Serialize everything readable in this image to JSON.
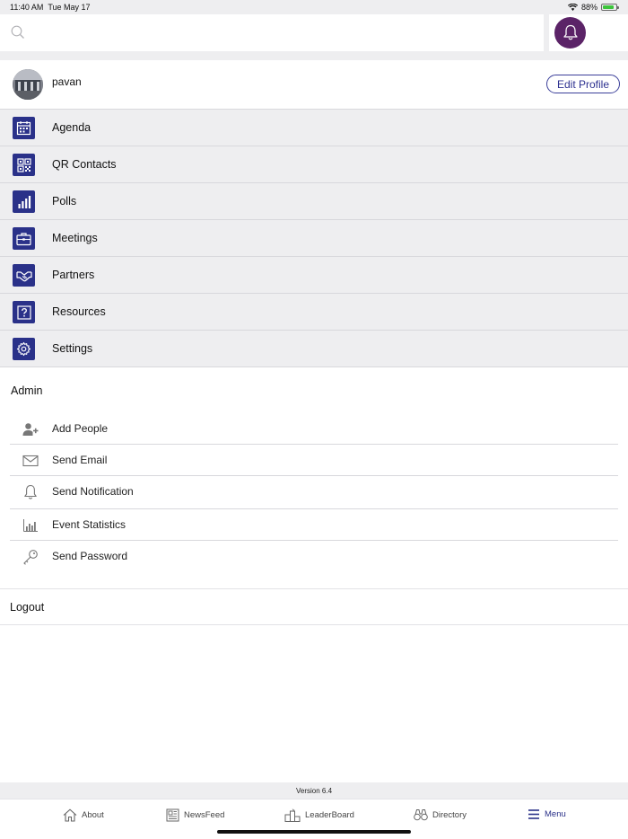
{
  "status_bar": {
    "time": "11:40 AM",
    "date": "Tue May 17",
    "battery": "88%"
  },
  "search": {
    "placeholder": "",
    "icon": "search-icon"
  },
  "header": {
    "notification_icon": "bell-icon",
    "accent": "#5b2367"
  },
  "profile": {
    "name": "pavan",
    "edit_label": "Edit Profile"
  },
  "menu": {
    "accent": "#2a3189",
    "items": [
      {
        "label": "Agenda",
        "icon": "calendar-icon"
      },
      {
        "label": "QR Contacts",
        "icon": "qr-code-icon"
      },
      {
        "label": "Polls",
        "icon": "bar-chart-icon"
      },
      {
        "label": "Meetings",
        "icon": "briefcase-icon"
      },
      {
        "label": "Partners",
        "icon": "handshake-icon"
      },
      {
        "label": "Resources",
        "icon": "question-icon"
      },
      {
        "label": "Settings",
        "icon": "gear-icon"
      }
    ]
  },
  "admin": {
    "header": "Admin",
    "items": [
      {
        "label": "Add People",
        "icon": "add-person-icon"
      },
      {
        "label": "Send Email",
        "icon": "envelope-icon"
      },
      {
        "label": "Send Notification",
        "icon": "bell-outline-icon"
      },
      {
        "label": "Event Statistics",
        "icon": "statistics-icon"
      },
      {
        "label": "Send Password",
        "icon": "key-icon"
      }
    ]
  },
  "logout": {
    "label": "Logout"
  },
  "footer": {
    "version": "Version  6.4"
  },
  "tabs": [
    {
      "label": "About",
      "icon": "home-icon",
      "active": false
    },
    {
      "label": "NewsFeed",
      "icon": "newspaper-icon",
      "active": false
    },
    {
      "label": "LeaderBoard",
      "icon": "podium-icon",
      "active": false
    },
    {
      "label": "Directory",
      "icon": "binoculars-icon",
      "active": false
    },
    {
      "label": "Menu",
      "icon": "hamburger-icon",
      "active": true
    }
  ]
}
